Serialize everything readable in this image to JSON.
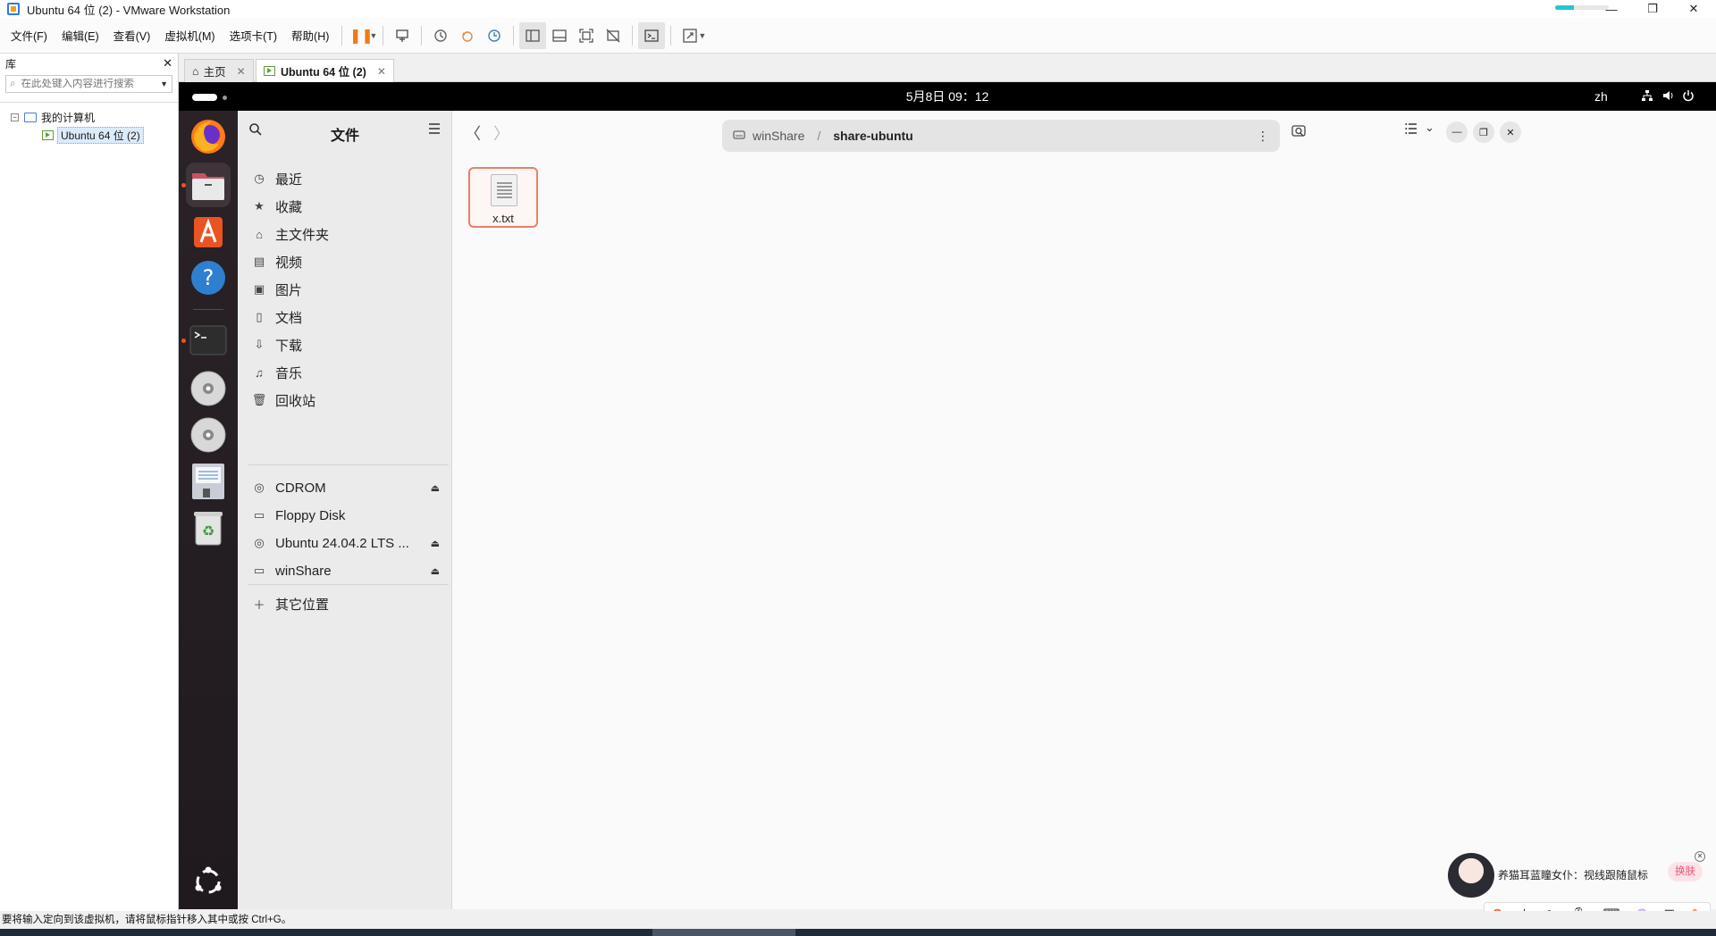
{
  "window": {
    "title": "Ubuntu 64 位 (2) - VMware Workstation",
    "progress": 0.35
  },
  "menu": [
    "文件(F)",
    "编辑(E)",
    "查看(V)",
    "虚拟机(M)",
    "选项卡(T)",
    "帮助(H)"
  ],
  "library": {
    "title": "库",
    "search_placeholder": "在此处键入内容进行搜索",
    "tree_root": "我的计算机",
    "tree_vm": "Ubuntu 64 位 (2)"
  },
  "tabs": [
    {
      "label": "主页"
    },
    {
      "label": "Ubuntu 64 位 (2)"
    }
  ],
  "guest": {
    "clock": "5月8日  09：12",
    "lang": "zh"
  },
  "files_app": {
    "title": "文件",
    "places": [
      {
        "label": "最近",
        "icon": "clock-icon"
      },
      {
        "label": "收藏",
        "icon": "star-icon"
      },
      {
        "label": "主文件夹",
        "icon": "home-icon"
      },
      {
        "label": "视频",
        "icon": "film-icon"
      },
      {
        "label": "图片",
        "icon": "image-icon"
      },
      {
        "label": "文档",
        "icon": "document-icon"
      },
      {
        "label": "下载",
        "icon": "download-icon"
      },
      {
        "label": "音乐",
        "icon": "music-icon"
      },
      {
        "label": "回收站",
        "icon": "trash-icon"
      }
    ],
    "devices": [
      {
        "label": "CDROM",
        "icon": "disc-icon",
        "eject": true
      },
      {
        "label": "Floppy Disk",
        "icon": "floppy-icon",
        "eject": false
      },
      {
        "label": "Ubuntu 24.04.2 LTS ...",
        "icon": "disc-icon",
        "eject": true
      },
      {
        "label": "winShare",
        "icon": "drive-icon",
        "eject": true
      }
    ],
    "other": "其它位置",
    "path": {
      "parent": "winShare",
      "current": "share-ubuntu"
    },
    "files": [
      {
        "name": "x.txt"
      }
    ]
  },
  "sogou": {
    "tip": "养猫耳蓝瞳女仆：视线跟随鼠标",
    "skin_button": "换肤",
    "ime_mode": "中"
  },
  "statusbar": {
    "text": "要将输入定向到该虚拟机，请将鼠标指针移入其中或按 Ctrl+G。"
  }
}
